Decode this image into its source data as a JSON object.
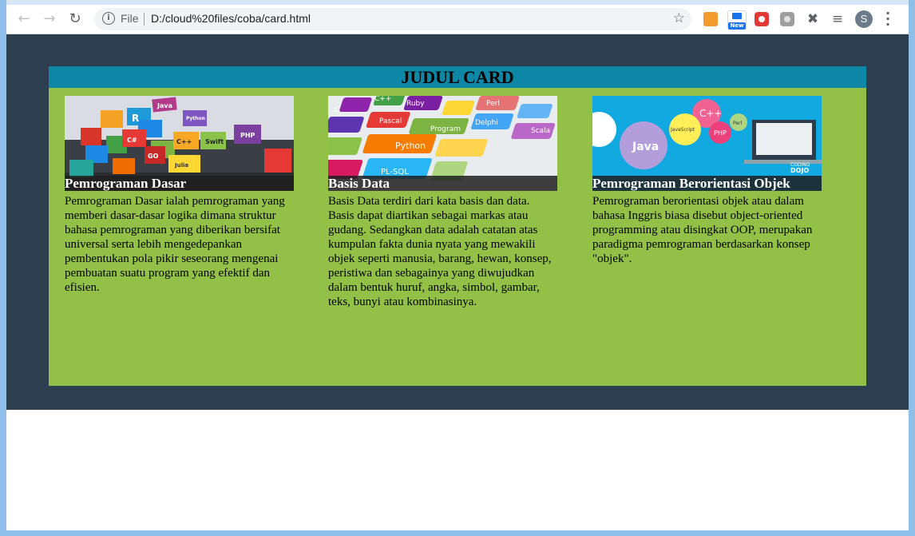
{
  "browser": {
    "file_label": "File",
    "url": "D:/cloud%20files/coba/card.html",
    "profile_initial": "S",
    "ext_new_badge": "New",
    "icons": [
      "back-arrow-icon",
      "forward-arrow-icon",
      "reload-icon",
      "info-icon",
      "star-icon",
      "extensions-icon",
      "media-icon",
      "menu-icon"
    ]
  },
  "page": {
    "card_title": "JUDUL CARD",
    "colors": {
      "outer": "#2c3e50",
      "card": "#93c047",
      "header": "#0e86a6"
    },
    "items": [
      {
        "title": "Pemrograman Dasar",
        "description": "Pemrograman Dasar ialah pemrograman yang memberi dasar-dasar logika dimana struktur bahasa pemrograman yang diberikan bersifat universal serta lebih mengedepankan pembentukan pola pikir seseorang mengenai pembuatan suatu program yang efektif dan efisien.",
        "image_labels": [
          "Java",
          "R",
          "C#",
          "PHP",
          "C++",
          "Swift",
          "GO",
          "Python",
          "Julia"
        ]
      },
      {
        "title": "Basis Data",
        "description": "Basis Data terdiri dari kata basis dan data. Basis dapat diartikan sebagai markas atau gudang. Sedangkan data adalah catatan atas kumpulan fakta dunia nyata yang mewakili objek seperti manusia, barang, hewan, konsep, peristiwa dan sebagainya yang diwujudkan dalam bentuk huruf, angka, simbol, gambar, teks, bunyi atau kombinasinya.",
        "image_labels": [
          "C++",
          "Ruby",
          "Perl",
          "Pascal",
          "Delphi",
          "Program",
          "Python",
          "Scala",
          "PL-SQL",
          "C"
        ]
      },
      {
        "title": "Pemrograman Berorientasi Objek",
        "description": "Pemrograman berorientasi objek atau dalam bahasa Inggris biasa disebut object-oriented programming atau disingkat OOP, merupakan paradigma pemrograman berdasarkan konsep \"objek\".",
        "image_labels": [
          "Java",
          "C++",
          "PHP",
          "JavaScript",
          "Perl",
          "CODING",
          "DOJO"
        ]
      }
    ]
  }
}
